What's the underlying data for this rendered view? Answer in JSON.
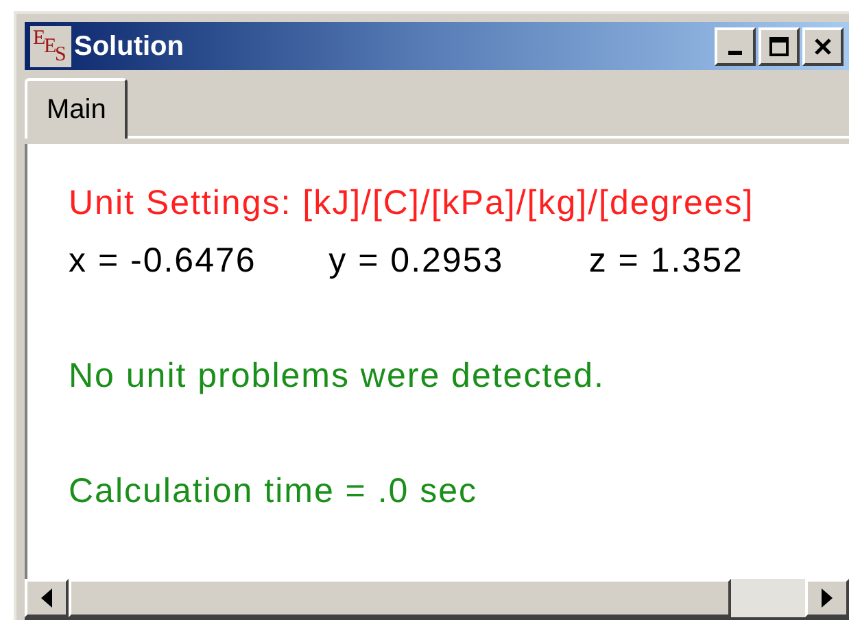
{
  "window": {
    "title": "Solution",
    "logo": [
      "E",
      "E",
      "S"
    ]
  },
  "tabs": [
    {
      "label": "Main",
      "selected": true
    }
  ],
  "lines": [
    {
      "kind": "text",
      "text": "Unit Settings: [kJ]/[C]/[kPa]/[kg]/[degrees]",
      "color": "#ff2020"
    },
    {
      "kind": "values",
      "values": [
        "x = -0.6476",
        "y = 0.2953",
        "z = 1.352"
      ]
    },
    {
      "kind": "gap"
    },
    {
      "kind": "text",
      "text": "No unit problems were detected.",
      "color": "#1a8f1a"
    },
    {
      "kind": "gap"
    },
    {
      "kind": "text",
      "text": "Calculation time = .0 sec",
      "color": "#1a8f1a"
    }
  ]
}
